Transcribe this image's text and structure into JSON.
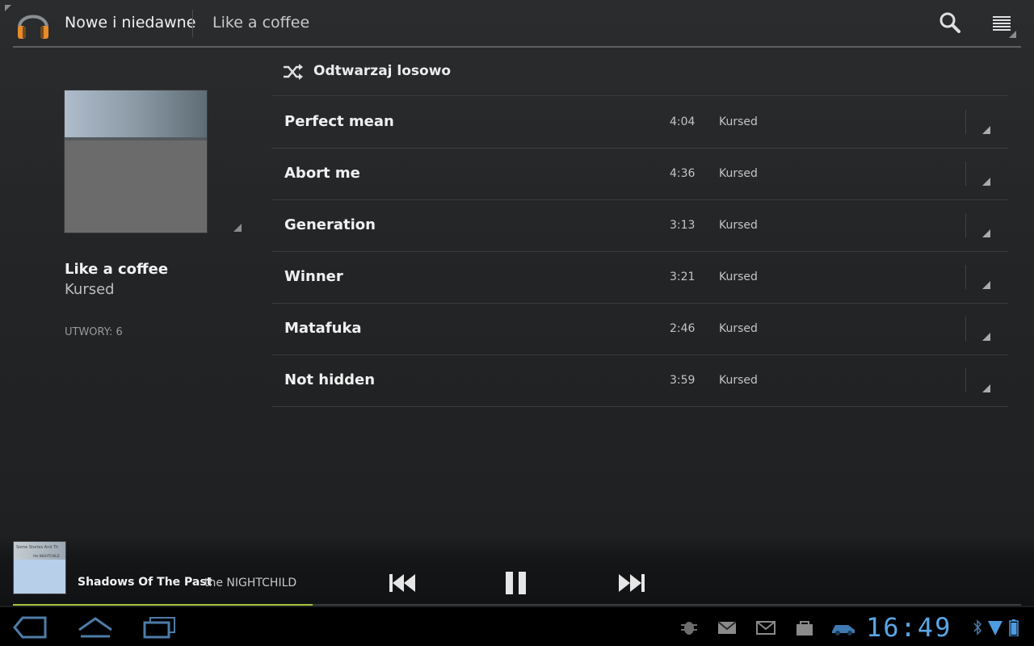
{
  "action_bar": {
    "title": "Nowe i niedawne",
    "subtitle": "Like a coffee",
    "app_icon": "headphones-icon",
    "search_icon": "search-icon",
    "menu_icon": "menu-icon"
  },
  "album": {
    "title": "Like a coffee",
    "artist": "Kursed",
    "track_count_label": "UTWORY: 6"
  },
  "shuffle": {
    "label": "Odtwarzaj losowo",
    "icon": "shuffle-icon"
  },
  "tracks": [
    {
      "title": "Perfect mean",
      "duration": "4:04",
      "artist": "Kursed"
    },
    {
      "title": "Abort me",
      "duration": "4:36",
      "artist": "Kursed"
    },
    {
      "title": "Generation",
      "duration": "3:13",
      "artist": "Kursed"
    },
    {
      "title": "Winner",
      "duration": "3:21",
      "artist": "Kursed"
    },
    {
      "title": "Matafuka",
      "duration": "2:46",
      "artist": "Kursed"
    },
    {
      "title": "Not hidden",
      "duration": "3:59",
      "artist": "Kursed"
    }
  ],
  "now_playing": {
    "title": "Shadows Of The Past",
    "artist": "the NIGHTCHILD",
    "art_text_top": "Some Stories And Th",
    "art_text_sub": "the NIGHTCHILD",
    "progress": 0.297,
    "controls": [
      "previous-icon",
      "pause-icon",
      "next-icon"
    ]
  },
  "system_bar": {
    "clock": "16:49",
    "nav_icons": [
      "back-icon",
      "home-icon",
      "recent-apps-icon"
    ],
    "notification_icons": [
      "debug-icon",
      "email-icon",
      "gmail-icon",
      "market-icon",
      "car-icon",
      "bluetooth-icon",
      "wifi-icon",
      "battery-icon"
    ]
  },
  "colors": {
    "accent_progress": "#a7c23d",
    "clock": "#5aa7e6"
  }
}
